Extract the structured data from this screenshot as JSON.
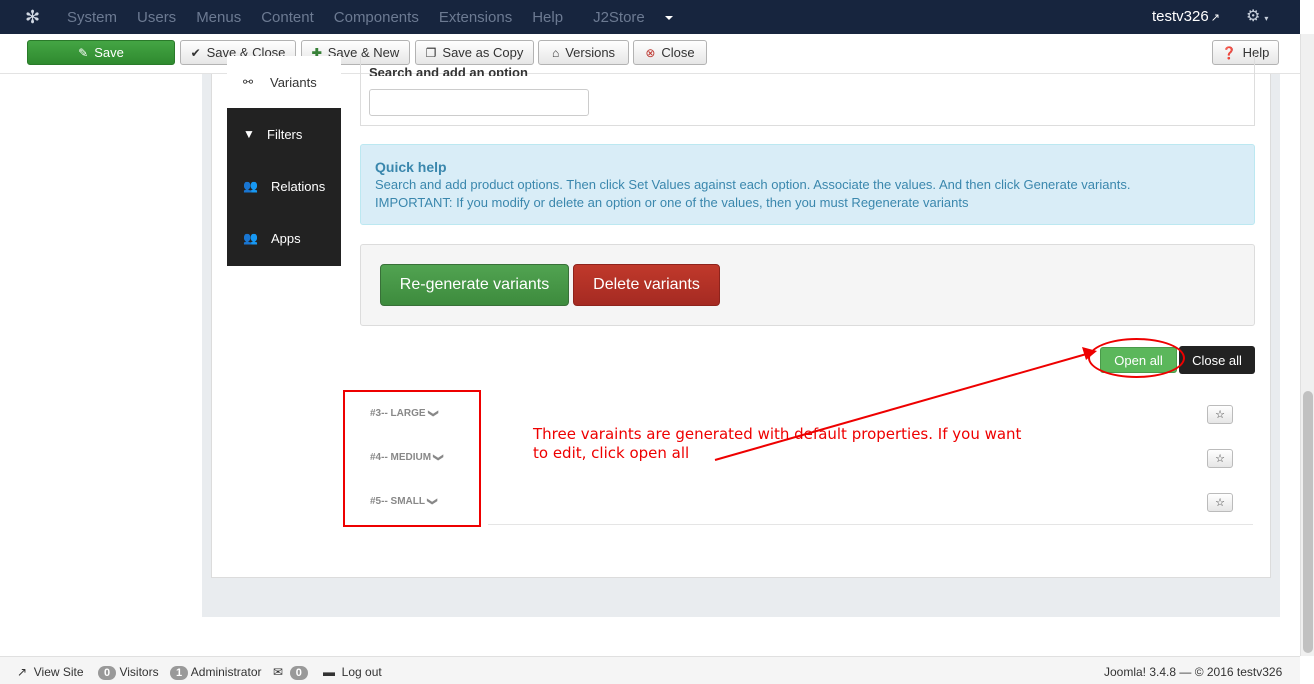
{
  "topnav": {
    "logo_icon": "joomla-icon",
    "menu": [
      "System",
      "Users",
      "Menus",
      "Content",
      "Components",
      "Extensions",
      "Help"
    ],
    "j2store": "J2Store",
    "user": "testv326",
    "gear_icon": "gear-icon"
  },
  "toolbar": {
    "save": "Save",
    "save_close": "Save & Close",
    "save_new": "Save & New",
    "save_copy": "Save as Copy",
    "versions": "Versions",
    "close": "Close",
    "help": "Help"
  },
  "tabs": {
    "variants": "Variants",
    "filters": "Filters",
    "relations": "Relations",
    "apps": "Apps"
  },
  "options": {
    "label": "Search and add an option",
    "input_value": ""
  },
  "quick_help": {
    "title": "Quick help",
    "line1": "Search and add product options. Then click Set Values against each option. Associate the values. And then click Generate variants.",
    "line2": "IMPORTANT: If you modify or delete an option or one of the values, then you must Regenerate variants"
  },
  "actions": {
    "regenerate": "Re-generate variants",
    "delete": "Delete variants",
    "open_all": "Open all",
    "close_all": "Close all"
  },
  "variants": [
    {
      "label": "#3-- LARGE"
    },
    {
      "label": "#4-- MEDIUM"
    },
    {
      "label": "#5-- SMALL"
    }
  ],
  "annotation": {
    "text": "Three varaints are generated with default properties. If you want to edit, click open all",
    "color": "#ee0000"
  },
  "status": {
    "view_site": "View Site",
    "visitors_count": "0",
    "visitors": "Visitors",
    "admin_count": "1",
    "administrator": "Administrator",
    "messages_count": "0",
    "logout": "Log out",
    "version": "Joomla! 3.4.8 — © 2016 testv326"
  },
  "colors": {
    "nav_bg": "#17253e",
    "save_green": "#3d953d",
    "info_bg": "#d9edf7",
    "danger": "#b33127"
  }
}
